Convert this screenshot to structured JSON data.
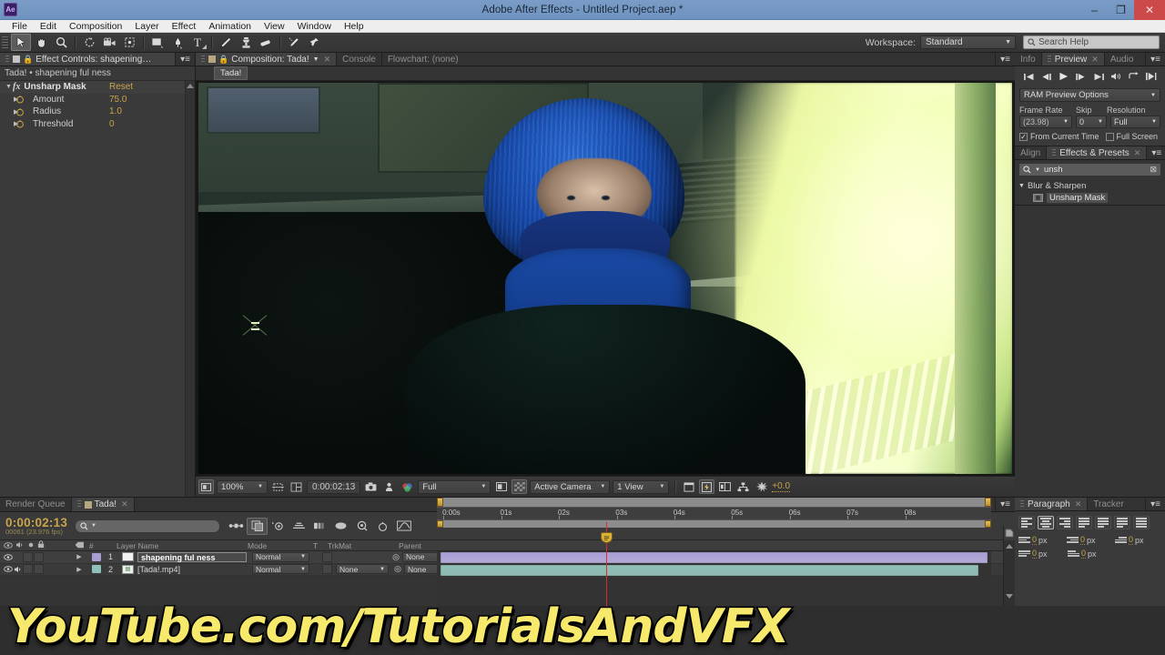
{
  "window": {
    "title": "Adobe After Effects - Untitled Project.aep *",
    "logo": "Ae",
    "minimize": "–",
    "maximize": "❐",
    "close": "✕"
  },
  "menubar": {
    "items": [
      "File",
      "Edit",
      "Composition",
      "Layer",
      "Effect",
      "Animation",
      "View",
      "Window",
      "Help"
    ]
  },
  "toolbar": {
    "tools": [
      {
        "name": "selection-tool",
        "glyph": "➤"
      },
      {
        "name": "hand-tool",
        "glyph": "✋"
      },
      {
        "name": "zoom-tool",
        "glyph": "🔍"
      },
      {
        "name": "rotation-tool",
        "glyph": "↻"
      },
      {
        "name": "camera-tool",
        "glyph": "🎥"
      },
      {
        "name": "pan-behind-tool",
        "glyph": "⛶"
      },
      {
        "name": "shape-tool",
        "glyph": "▢"
      },
      {
        "name": "pen-tool",
        "glyph": "✒"
      },
      {
        "name": "text-tool",
        "glyph": "T"
      },
      {
        "name": "brush-tool",
        "glyph": "/"
      },
      {
        "name": "clone-stamp-tool",
        "glyph": "⚒"
      },
      {
        "name": "eraser-tool",
        "glyph": "▰"
      },
      {
        "name": "roto-brush-tool",
        "glyph": "✣"
      },
      {
        "name": "puppet-pin-tool",
        "glyph": "✦"
      }
    ],
    "workspace_label": "Workspace:",
    "workspace_value": "Standard",
    "search_help_placeholder": "Search Help"
  },
  "effect_controls": {
    "tab_label": "Effect Controls: shapening ful ness",
    "header": "Tada!  •  shapening ful ness",
    "effect_name": "Unsharp Mask",
    "reset_label": "Reset",
    "properties": [
      {
        "label": "Amount",
        "value": "75.0"
      },
      {
        "label": "Radius",
        "value": "1.0"
      },
      {
        "label": "Threshold",
        "value": "0"
      }
    ]
  },
  "composition": {
    "tabs": [
      {
        "label": "Composition: Tada!",
        "active": true
      },
      {
        "label": "Console",
        "active": false
      },
      {
        "label": "Flowchart: (none)",
        "active": false
      }
    ],
    "breadcrumb_chip": "Tada!",
    "toolbar": {
      "magnification": "100%",
      "timecode": "0:00:02:13",
      "resolution": "Full",
      "view": "Active Camera",
      "view_count": "1 View",
      "exposure": "+0.0"
    }
  },
  "preview_panel": {
    "tabs": [
      "Info",
      "Preview",
      "Audio"
    ],
    "active_tab": "Preview",
    "transport": [
      "⏮",
      "◀❙",
      "▶",
      "❙▶",
      "⏭",
      "🔊",
      "⤴",
      "❙▶"
    ],
    "ram_options_label": "RAM Preview Options",
    "frame_rate_label": "Frame Rate",
    "frame_rate_value": "(23.98)",
    "skip_label": "Skip",
    "skip_value": "0",
    "resolution_label": "Resolution",
    "resolution_value": "Full",
    "from_current_time": "From Current Time",
    "full_screen": "Full Screen"
  },
  "effects_presets": {
    "tabs": [
      "Align",
      "Effects & Presets"
    ],
    "active_tab": "Effects & Presets",
    "search_value": "unsh",
    "category": "Blur & Sharpen",
    "result": "Unsharp Mask"
  },
  "timeline": {
    "tabs": [
      {
        "label": "Render Queue",
        "active": false
      },
      {
        "label": "Tada!",
        "active": true
      }
    ],
    "current_time": "0:00:02:13",
    "frame_info": "00061 (23.976 fps)",
    "search_placeholder": "",
    "columns": [
      "Layer Name",
      "Mode",
      "T",
      "TrkMat",
      "Parent"
    ],
    "hash_col": "#",
    "layers": [
      {
        "index": "1",
        "name": "shapening ful ness",
        "mode": "Normal",
        "trkmat": "",
        "parent": "None",
        "color": "#a99ed4",
        "selected": true,
        "has_audio": false
      },
      {
        "index": "2",
        "name": "[Tada!.mp4]",
        "mode": "Normal",
        "trkmat": "None",
        "parent": "None",
        "color": "#8fc0b8",
        "selected": false,
        "has_audio": true
      }
    ],
    "ruler_ticks": [
      "0:00s",
      "01s",
      "02s",
      "03s",
      "04s",
      "05s",
      "06s",
      "07s",
      "08s"
    ]
  },
  "paragraph_panel": {
    "tabs": [
      "Paragraph",
      "Tracker"
    ],
    "active_tab": "Paragraph",
    "align_buttons": [
      "align-left",
      "align-center",
      "align-right",
      "justify-last-left",
      "justify-last-center",
      "justify-last-right",
      "justify-all"
    ],
    "selected_align_index": 1,
    "fields": [
      {
        "name": "indent-left",
        "value": "0",
        "unit": "px"
      },
      {
        "name": "indent-right",
        "value": "0",
        "unit": "px"
      },
      {
        "name": "indent-first-line",
        "value": "0",
        "unit": "px"
      },
      {
        "name": "space-before",
        "value": "0",
        "unit": "px"
      },
      {
        "name": "space-after",
        "value": "0",
        "unit": "px"
      }
    ]
  },
  "watermark": {
    "text": "YouTube.com/TutorialsAndVFX",
    "color": "#f7e96b"
  }
}
